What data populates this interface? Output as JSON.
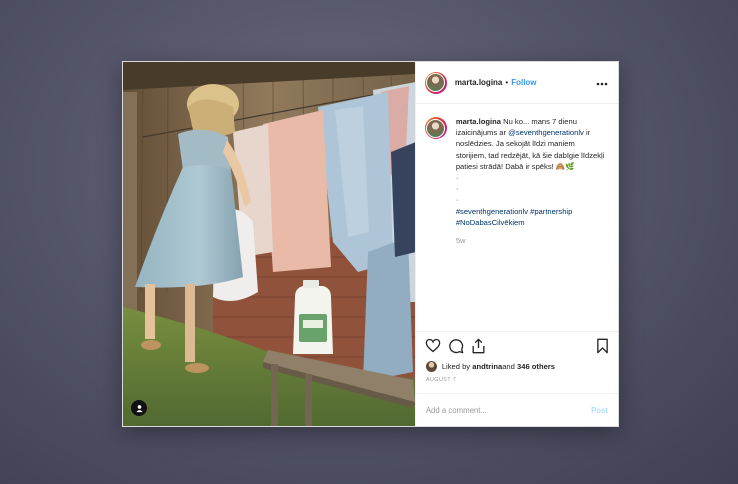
{
  "post": {
    "username": "marta.logina",
    "separator": "•",
    "follow_label": "Follow",
    "more_icon": "more-horizontal-icon",
    "caption": {
      "username": "marta.logina",
      "text_1": "Nu ko... mans 7 dienu izaicinājums ar ",
      "mention": "@seventhgenerationlv",
      "text_2": " ir noslēdzies. Ja sekojāt līdzi maniem storijiem, tad redzējāt, kā šie dabīgie līdzekļi patiesi strādā! Dabā ir spēks! 🙈🌿",
      "dots": [
        "·",
        "·",
        "·"
      ],
      "hashtags": "#seventhgenerationlv #partnership #NoDabasCilvēkiem"
    },
    "time_ago": "5w",
    "likes": {
      "prefix": "Liked by ",
      "user": "andtrina",
      "conjunction": " and ",
      "others": "346 others"
    },
    "date": "AUGUST 7",
    "comment_placeholder": "Add a comment...",
    "post_label": "Post"
  },
  "icons": {
    "like": "heart-icon",
    "comment": "comment-icon",
    "share": "share-icon",
    "save": "bookmark-icon",
    "tagged": "user-tag-icon"
  },
  "colors": {
    "link": "#3897f0",
    "mention": "#003569",
    "post_disabled": "#b2dffc"
  }
}
